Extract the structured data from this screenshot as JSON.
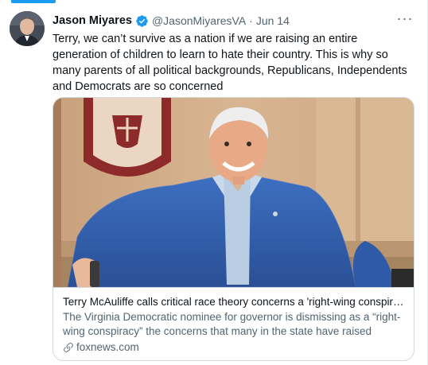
{
  "tweet": {
    "author_name": "Jason Miyares",
    "handle": "@JasonMiyaresVA",
    "separator": "·",
    "date": "Jun 14",
    "more_label": "···",
    "text": "Terry, we can’t survive as a nation if we are raising an entire generation of children to learn to hate their country.  This is why so many parents of all political backgrounds, Republicans, Independents and Democrats are so concerned"
  },
  "card": {
    "title": "Terry McAuliffe calls critical race theory concerns a 'right-wing conspira...",
    "description": "The Virginia Democratic nominee for governor is dismissing as a “right-wing conspiracy” the concerns that many in the state have raised abou...",
    "domain": "foxnews.com"
  },
  "colors": {
    "accent": "#1d9bf0",
    "secondary_text": "#536471",
    "border": "#cfd9de"
  },
  "icons": {
    "verified": "verified-badge-icon",
    "more": "more-icon",
    "link": "link-icon"
  }
}
